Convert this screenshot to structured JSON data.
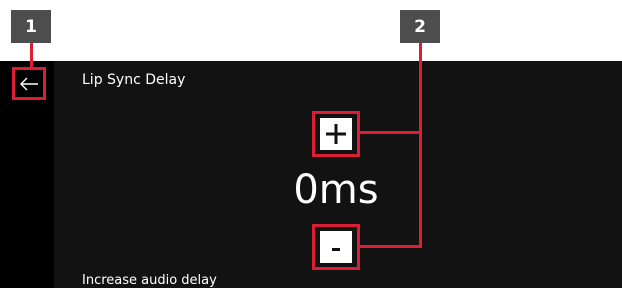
{
  "annotations": {
    "badge_1": "1",
    "badge_2": "2",
    "accent_color": "#dc1e35",
    "badge_color": "#4d4d4d"
  },
  "screen": {
    "background": "#121212",
    "title": "Lip Sync Delay",
    "back_icon": "arrow-left-icon",
    "increase_icon": "plus-icon",
    "decrease_icon": "minus-icon",
    "value": "0ms",
    "hint": "Increase audio delay"
  }
}
